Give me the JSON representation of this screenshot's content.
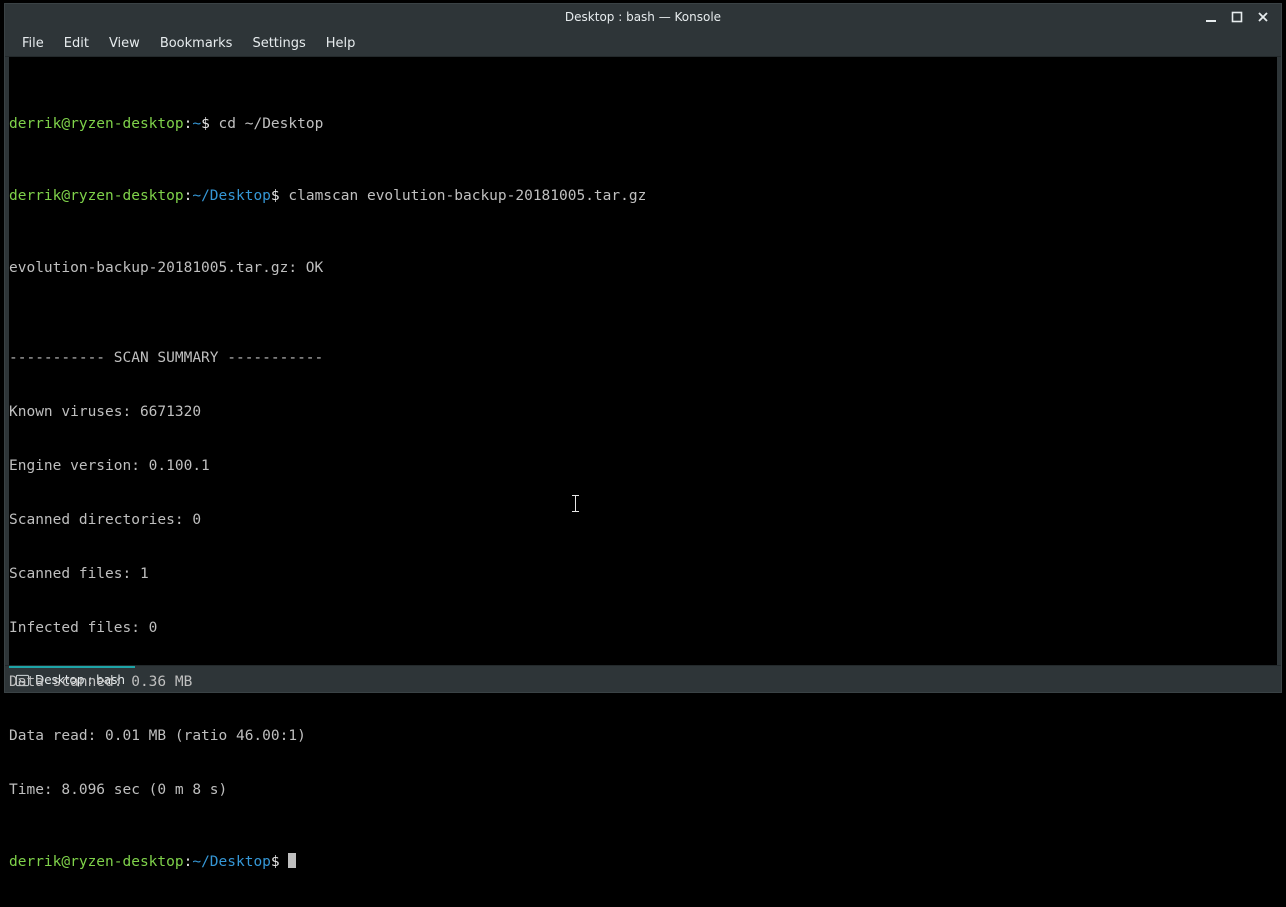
{
  "window": {
    "title": "Desktop : bash — Konsole"
  },
  "menu": {
    "file": "File",
    "edit": "Edit",
    "view": "View",
    "bookmarks": "Bookmarks",
    "settings": "Settings",
    "help": "Help"
  },
  "prompt": {
    "user_host": "derrik@ryzen-desktop",
    "colon": ":",
    "home_tilde": "~",
    "desktop_path": "~/Desktop",
    "dollar": "$"
  },
  "commands": {
    "cd": "cd ~/Desktop",
    "clamscan": "clamscan evolution-backup-20181005.tar.gz"
  },
  "output": {
    "file_ok": "evolution-backup-20181005.tar.gz: OK",
    "blank": "",
    "divider": "----------- SCAN SUMMARY -----------",
    "known_viruses": "Known viruses: 6671320",
    "engine_version": "Engine version: 0.100.1",
    "scanned_dirs": "Scanned directories: 0",
    "scanned_files": "Scanned files: 1",
    "infected_files": "Infected files: 0",
    "data_scanned": "Data scanned: 0.36 MB",
    "data_read": "Data read: 0.01 MB (ratio 46.00:1)",
    "time": "Time: 8.096 sec (0 m 8 s)"
  },
  "tab": {
    "label": "Desktop : bash"
  }
}
